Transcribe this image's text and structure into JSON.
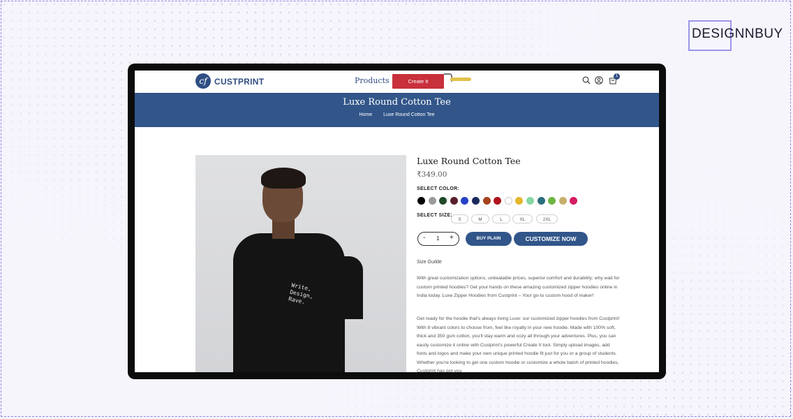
{
  "brand": {
    "name": "DESIGNNBUY"
  },
  "site": {
    "logo_text": "CUSTPRINT",
    "logo_mark": "cf",
    "nav_products": "Products",
    "create_button": "Create It",
    "cart_count": "1",
    "icons": [
      "search-icon",
      "user-icon",
      "cart-icon"
    ]
  },
  "banner": {
    "title": "Luxe Round Cotton Tee",
    "breadcrumb": [
      "Home",
      "Luxe Round Cotton Tee"
    ]
  },
  "product": {
    "title": "Luxe Round Cotton Tee",
    "price": "₹349.00",
    "image_print_text": "Write,\nDesign,\nRave.",
    "select_color_label": "SELECT COLOR:",
    "colors": [
      "#000000",
      "#9a9a9a",
      "#1f4a2a",
      "#5a1e2b",
      "#2742c7",
      "#1b2a5c",
      "#a5441c",
      "#b0131d",
      "#ffffff",
      "#e5b72d",
      "#86d7a4",
      "#2c6e7e",
      "#6db544",
      "#c7b06b",
      "#d31c64"
    ],
    "select_size_label": "SELECT SIZE:",
    "sizes": [
      "S",
      "M",
      "L",
      "XL",
      "2XL"
    ],
    "quantity": {
      "minus": "-",
      "value": "1",
      "plus": "+"
    },
    "buy_plain": "BUY PLAIN",
    "customize_now": "CUSTOMIZE NOW",
    "size_guide": "Size Guilde",
    "description_1": "With great customization options, unbeatable prices, superior comfort and durability; why wait for custom printed hoodies? Get your hands on these amazing customized zipper hoodies online in India today. Luxe Zipper Hoodies from Custprint – Your go-to custom hood of maker!",
    "description_2": "Get ready for the hoodie that's always living Luxe: our customized zipper hoodies from Custprint! With 8 vibrant colors to choose from, feel like royalty in your new hoodie. Made with 100% soft, thick and 350 gsm cotton, you'll stay warm and cozy all through your adventures. Plus, you can easily customize it online with Custprint's powerful Create It tool. Simply upload images, add fonts and logos and make your own unique printed hoodie fit just for you or a group of students. Whether you're looking to get one custom hoodie or customize a whole batch of printed hoodies, Custprint has got you"
  }
}
